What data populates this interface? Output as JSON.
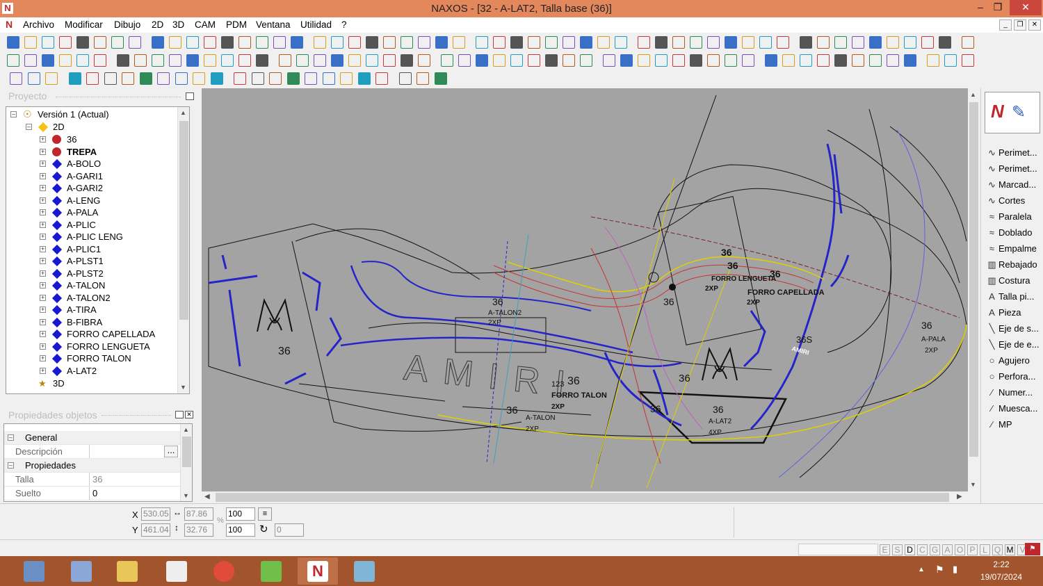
{
  "window": {
    "title": "NAXOS - [32 - A-LAT2, Talla base (36)]",
    "app_icon_letter": "N"
  },
  "menu": [
    "Archivo",
    "Modificar",
    "Dibujo",
    "2D",
    "3D",
    "CAM",
    "PDM",
    "Ventana",
    "Utilidad",
    "?"
  ],
  "project": {
    "title": "Proyecto",
    "root": "Versión 1 (Actual)",
    "folder_2d": "2D",
    "items": [
      {
        "label": "36",
        "kind": "red"
      },
      {
        "label": "TREPA",
        "kind": "red",
        "bold": true
      },
      {
        "label": "A-BOLO",
        "kind": "blue"
      },
      {
        "label": "A-GARI1",
        "kind": "blue"
      },
      {
        "label": "A-GARI2",
        "kind": "blue"
      },
      {
        "label": "A-LENG",
        "kind": "blue"
      },
      {
        "label": "A-PALA",
        "kind": "blue"
      },
      {
        "label": "A-PLIC",
        "kind": "blue"
      },
      {
        "label": "A-PLIC LENG",
        "kind": "blue"
      },
      {
        "label": "A-PLIC1",
        "kind": "blue"
      },
      {
        "label": "A-PLST1",
        "kind": "blue"
      },
      {
        "label": "A-PLST2",
        "kind": "blue"
      },
      {
        "label": "A-TALON",
        "kind": "blue"
      },
      {
        "label": "A-TALON2",
        "kind": "blue"
      },
      {
        "label": "A-TIRA",
        "kind": "blue"
      },
      {
        "label": "B-FIBRA",
        "kind": "blue"
      },
      {
        "label": "FORRO CAPELLADA",
        "kind": "blue"
      },
      {
        "label": "FORRO LENGUETA",
        "kind": "blue"
      },
      {
        "label": "FORRO TALON",
        "kind": "blue"
      },
      {
        "label": "A-LAT2",
        "kind": "blue"
      }
    ],
    "folder_3d": "3D"
  },
  "properties": {
    "title": "Propiedades objetos",
    "group_general": "General",
    "descripcion_label": "Descripción",
    "descripcion_btn": "...",
    "group_props": "Propiedades",
    "talla_label": "Talla",
    "talla_value": "36",
    "suelto_label": "Suelto",
    "suelto_value": "0"
  },
  "tools": [
    "Perimet...",
    "Perimet...",
    "Marcad...",
    "Cortes",
    "Paralela",
    "Doblado",
    "Empalme",
    "Rebajado",
    "Costura",
    "Talla pi...",
    "Pieza",
    "Eje de s...",
    "Eje de e...",
    "Agujero",
    "Perfora...",
    "Numer...",
    "Muesca...",
    "MP"
  ],
  "coords": {
    "x_label": "X",
    "y_label": "Y",
    "x": "530.05",
    "y": "461.04",
    "w": "87.86",
    "h": "32.76",
    "scale_x": "100",
    "scale_y": "100",
    "percent": "%",
    "rotation": "0"
  },
  "status_modes": [
    "E",
    "S",
    "D",
    "C",
    "G",
    "A",
    "O",
    "P",
    "L",
    "Q",
    "M",
    "V"
  ],
  "canvas_labels": {
    "brand": "AMIRI",
    "size": "36",
    "forro_talon_num": "123",
    "forro_talon": "FORRO TALON",
    "xp2": "2XP",
    "xp4": "4XP",
    "a_talon": "A-TALON",
    "a_talon2": "A-TALON2",
    "a_lat2": "A-LAT2",
    "a_pala": "A-PALA",
    "forro_capellada": "FORRO CAPELLADA",
    "forro_lengueta": "FORRO LENGUETA",
    "size_36s": "36S",
    "amiri_small": "AMIRI"
  },
  "clock": {
    "time": "2:22",
    "date": "19/07/2024"
  },
  "colors": {
    "titlebar": "#e3875c",
    "taskbar": "#a2552d",
    "canvas": "#a3a3a3",
    "close": "#c9473c"
  }
}
